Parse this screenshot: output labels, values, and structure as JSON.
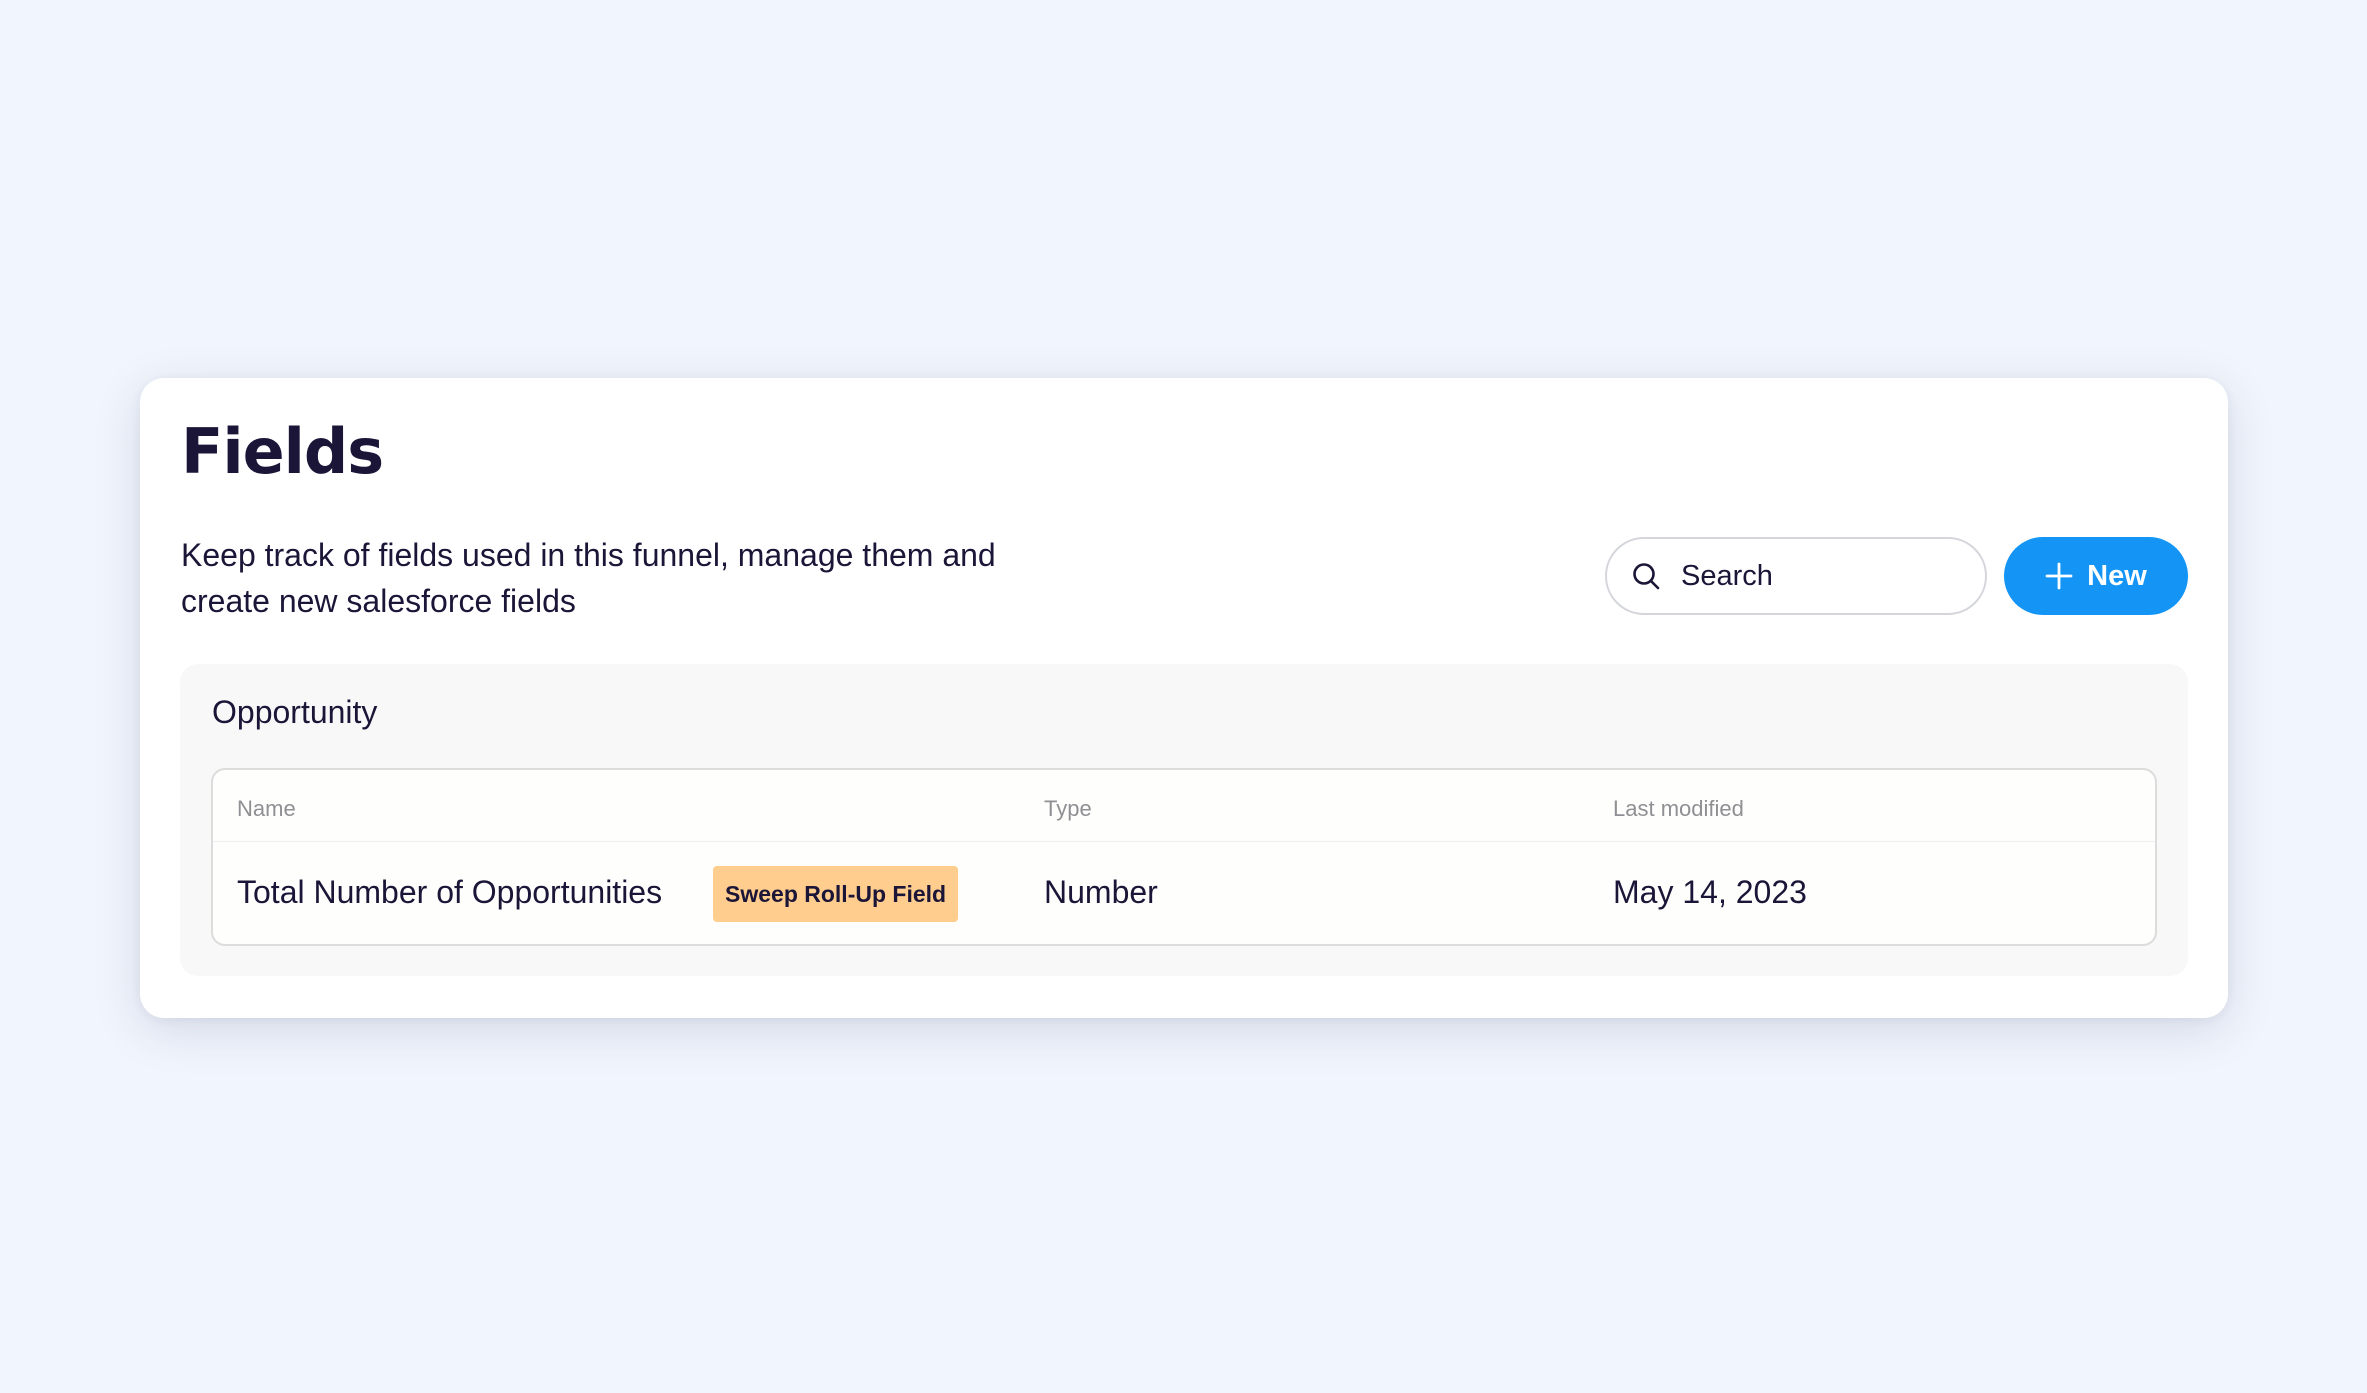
{
  "page": {
    "title": "Fields",
    "description_line1": "Keep track of fields used in this funnel, manage them and",
    "description_line2": "create new salesforce fields"
  },
  "search": {
    "placeholder": "Search",
    "icon": "search-icon"
  },
  "new_button": {
    "label": "New",
    "icon": "plus-icon"
  },
  "section": {
    "title": "Opportunity",
    "columns": [
      "Name",
      "Type",
      "Last modified"
    ],
    "rows": [
      {
        "name": "Total Number of Opportunities",
        "badge": "Sweep Roll-Up Field",
        "type": "Number",
        "last_modified": "May 14, 2023"
      }
    ]
  },
  "colors": {
    "background": "#f1f5fd",
    "accent": "#1495f6",
    "badge": "#ffcd8d",
    "text": "#1b1537"
  }
}
